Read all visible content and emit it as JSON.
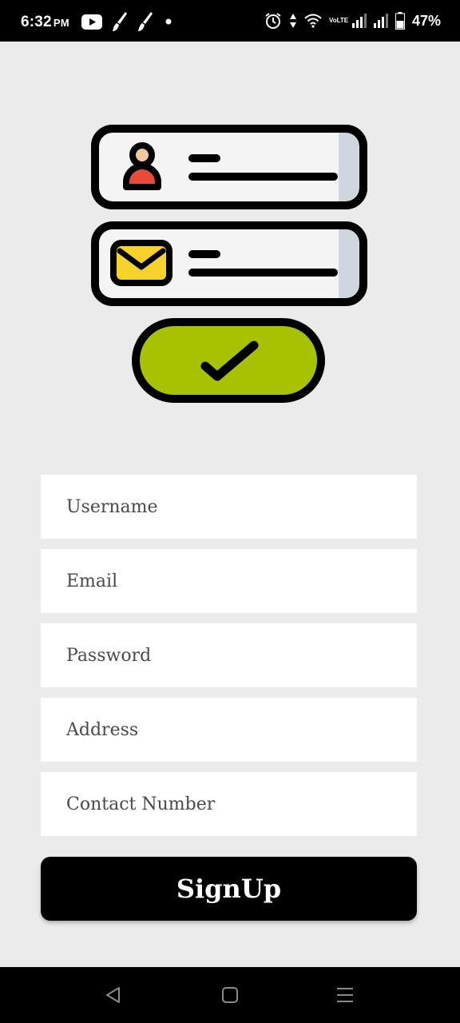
{
  "status_bar": {
    "time": "6:32",
    "ampm": "PM",
    "battery_percent": "47%",
    "network_label": "VoLTE",
    "left_icons": [
      "youtube-icon",
      "brush-icon",
      "brush-icon",
      "dot-icon"
    ],
    "right_icons": [
      "alarm-icon",
      "data-arrows-icon",
      "wifi-icon",
      "volte-icon",
      "signal-icon",
      "signal-icon",
      "battery-icon"
    ]
  },
  "illustration": {
    "icons": [
      "user-icon",
      "mail-icon",
      "checkmark-icon"
    ],
    "colors": {
      "user_head": "#f2c7a0",
      "user_body": "#e94a3a",
      "mail": "#f7d22d",
      "check_pill": "#a8c100",
      "card_fill": "#f4f4f4",
      "card_shade": "#cfd6de"
    }
  },
  "form": {
    "fields": [
      {
        "placeholder": "Username"
      },
      {
        "placeholder": "Email"
      },
      {
        "placeholder": "Password"
      },
      {
        "placeholder": "Address"
      },
      {
        "placeholder": "Contact Number"
      }
    ],
    "submit_label": "SignUp"
  },
  "nav_bar": {
    "icons": [
      "back-icon",
      "home-icon",
      "recents-menu-icon"
    ]
  }
}
